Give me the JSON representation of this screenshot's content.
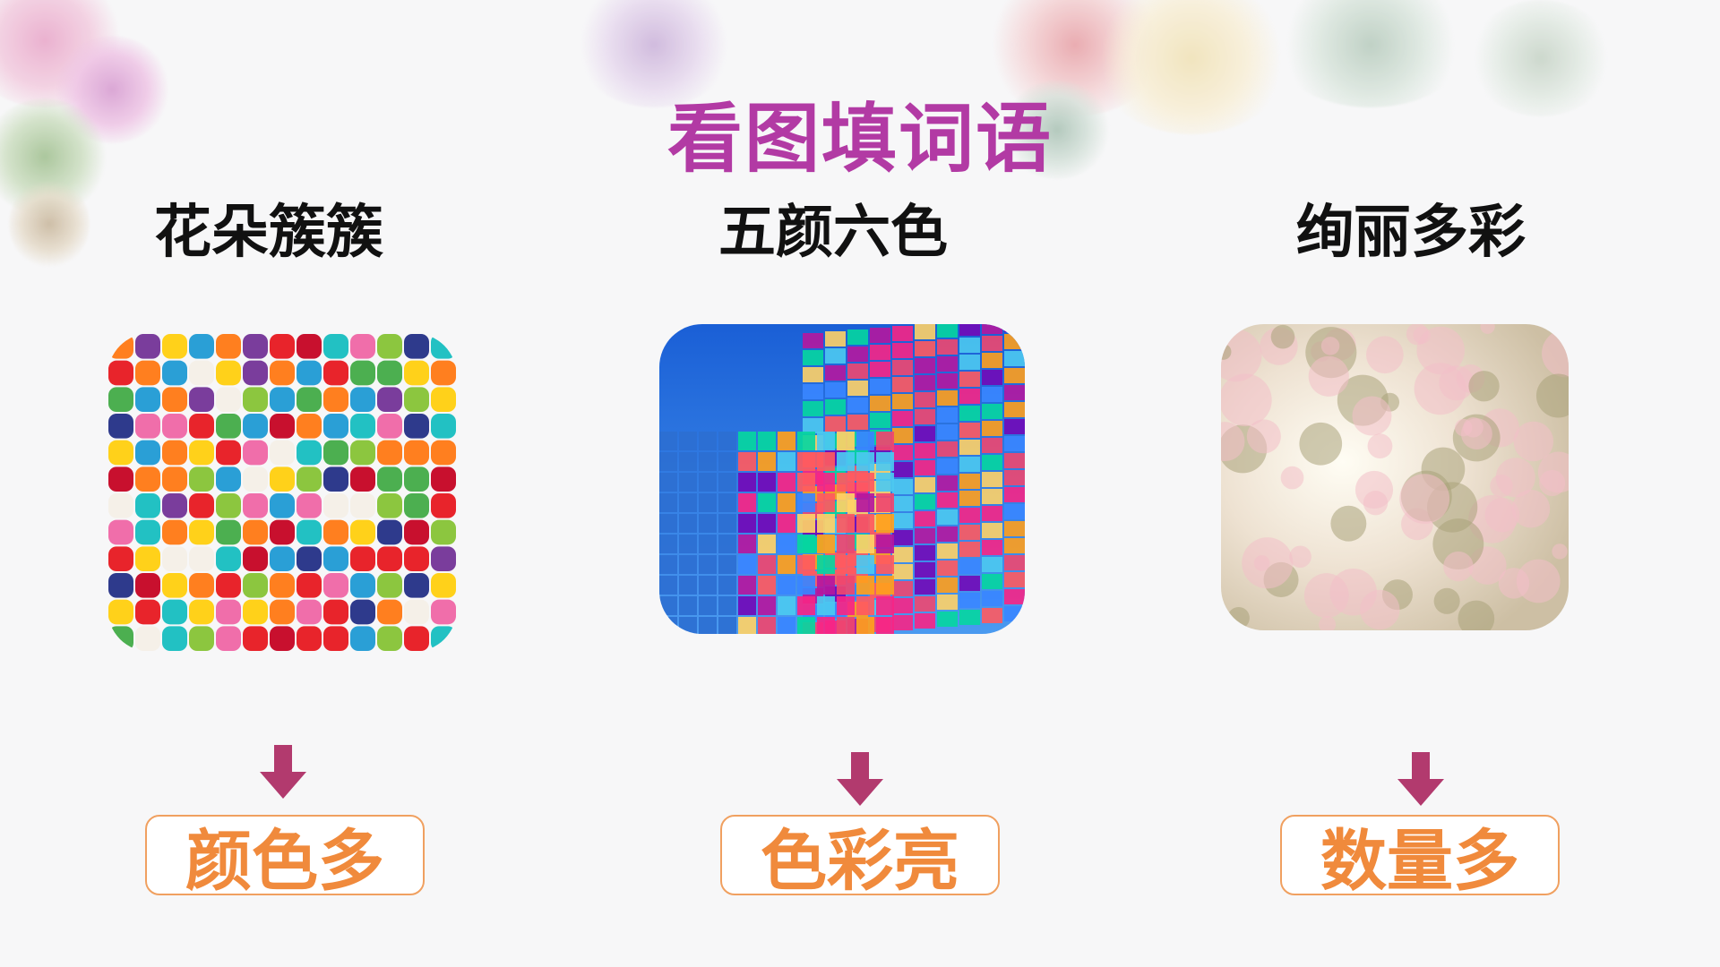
{
  "title": "看图填词语",
  "idioms": [
    "花朵簇簇",
    "五颜六色",
    "绚丽多彩"
  ],
  "answers": [
    "颜色多",
    "色彩亮",
    "数量多"
  ],
  "pictures": [
    {
      "name": "felt-balls-picture"
    },
    {
      "name": "glass-building-picture"
    },
    {
      "name": "cherry-blossom-picture"
    }
  ],
  "colors": {
    "title": "#b23aa4",
    "idiom": "#111111",
    "arrow": "#b23a6e",
    "answer_text": "#f08a3c",
    "answer_border": "#f0a060",
    "background": "#f7f7f8"
  }
}
